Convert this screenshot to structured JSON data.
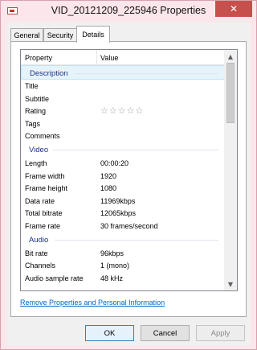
{
  "window": {
    "title": "VID_20121209_225946 Properties",
    "close_glyph": "✕",
    "title_icon": "video-file-icon"
  },
  "tabs": [
    {
      "label": "General"
    },
    {
      "label": "Security"
    },
    {
      "label": "Details",
      "active": true
    }
  ],
  "details": {
    "col_property": "Property",
    "col_value": "Value",
    "groups": {
      "description": "Description",
      "video": "Video",
      "audio": "Audio"
    },
    "description_rows": [
      {
        "key": "Title",
        "value": ""
      },
      {
        "key": "Subtitle",
        "value": ""
      },
      {
        "key": "Rating",
        "value": ""
      },
      {
        "key": "Tags",
        "value": ""
      },
      {
        "key": "Comments",
        "value": ""
      }
    ],
    "rating_stars": "☆☆☆☆☆",
    "video_rows": [
      {
        "key": "Length",
        "value": "00:00:20"
      },
      {
        "key": "Frame width",
        "value": "1920"
      },
      {
        "key": "Frame height",
        "value": "1080"
      },
      {
        "key": "Data rate",
        "value": "11969kbps"
      },
      {
        "key": "Total bitrate",
        "value": "12065kbps"
      },
      {
        "key": "Frame rate",
        "value": "30 frames/second"
      }
    ],
    "audio_rows": [
      {
        "key": "Bit rate",
        "value": "96kbps"
      },
      {
        "key": "Channels",
        "value": "1 (mono)"
      },
      {
        "key": "Audio sample rate",
        "value": "48 kHz"
      }
    ],
    "scroll_up": "▲",
    "scroll_down": "▼"
  },
  "remove_link": "Remove Properties and Personal Information",
  "buttons": {
    "ok": "OK",
    "cancel": "Cancel",
    "apply": "Apply"
  },
  "colors": {
    "titlebar": "#fbe6eb",
    "close": "#c7504c",
    "link": "#0066cc",
    "group_text": "#1e3287"
  }
}
